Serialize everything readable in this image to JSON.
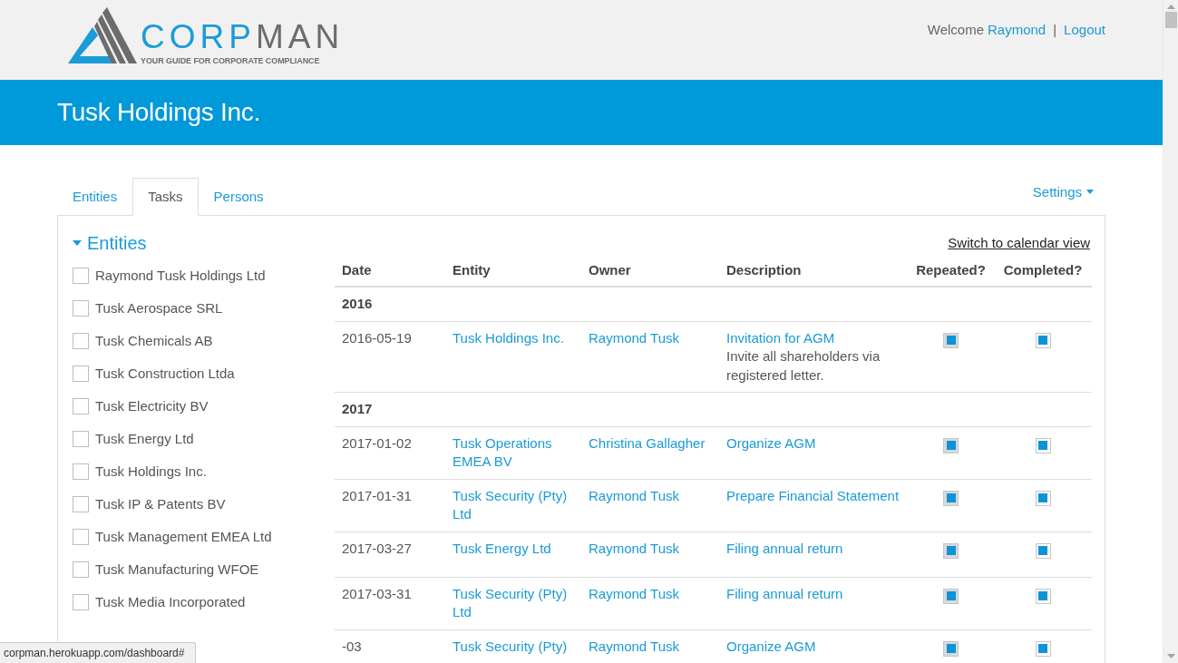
{
  "header": {
    "logo": {
      "wordmark": [
        {
          "text": "CORP",
          "color": "#1b9bd7"
        },
        {
          "text": "MAN",
          "color": "#6b6c6e"
        }
      ],
      "tagline": "YOUR GUIDE FOR CORPORATE COMPLIANCE"
    },
    "welcome": "Welcome",
    "user": "Raymond",
    "separator": "|",
    "logout": "Logout"
  },
  "banner": {
    "title": "Tusk Holdings Inc."
  },
  "tabs": [
    {
      "label": "Entities",
      "selected": false
    },
    {
      "label": "Tasks",
      "selected": true
    },
    {
      "label": "Persons",
      "selected": false
    }
  ],
  "settings": {
    "label": "Settings"
  },
  "entity_filter": {
    "title": "Entities",
    "expanded": true,
    "items": [
      {
        "label": "Raymond Tusk Holdings Ltd",
        "checked": false
      },
      {
        "label": "Tusk Aerospace SRL",
        "checked": false
      },
      {
        "label": "Tusk Chemicals AB",
        "checked": false
      },
      {
        "label": "Tusk Construction Ltda",
        "checked": false
      },
      {
        "label": "Tusk Electricity BV",
        "checked": false
      },
      {
        "label": "Tusk Energy Ltd",
        "checked": false
      },
      {
        "label": "Tusk Holdings Inc.",
        "checked": false
      },
      {
        "label": "Tusk IP & Patents BV",
        "checked": false
      },
      {
        "label": "Tusk Management EMEA Ltd",
        "checked": false
      },
      {
        "label": "Tusk Manufacturing WFOE",
        "checked": false
      },
      {
        "label": "Tusk Media Incorporated",
        "checked": false
      }
    ]
  },
  "calendar_link": "Switch to calendar view",
  "table": {
    "columns": [
      "Date",
      "Entity",
      "Owner",
      "Description",
      "Repeated?",
      "Completed?"
    ],
    "groups": [
      {
        "year": "2016",
        "rows": [
          {
            "date": "2016-05-19",
            "entity": "Tusk Holdings Inc.",
            "owner": "Raymond Tusk",
            "description": "Invitation for AGM",
            "note": "Invite all shareholders via registered letter.",
            "repeated": {
              "checked": true,
              "disabled": true
            },
            "completed": {
              "checked": true,
              "disabled": false
            }
          }
        ]
      },
      {
        "year": "2017",
        "rows": [
          {
            "date": "2017-01-02",
            "entity": "Tusk Operations EMEA BV",
            "owner": "Christina Gallagher",
            "description": "Organize AGM",
            "repeated": {
              "checked": true,
              "disabled": true
            },
            "completed": {
              "checked": true,
              "disabled": false
            }
          },
          {
            "date": "2017-01-31",
            "entity": "Tusk Security (Pty) Ltd",
            "owner": "Raymond Tusk",
            "description": "Prepare Financial Statement",
            "repeated": {
              "checked": true,
              "disabled": true
            },
            "completed": {
              "checked": true,
              "disabled": false
            }
          },
          {
            "date": "2017-03-27",
            "entity": "Tusk Energy Ltd",
            "owner": "Raymond Tusk",
            "description": "Filing annual return",
            "repeated": {
              "checked": true,
              "disabled": true
            },
            "completed": {
              "checked": true,
              "disabled": false
            }
          },
          {
            "date": "2017-03-31",
            "entity": "Tusk Security (Pty) Ltd",
            "owner": "Raymond Tusk",
            "description": "Filing annual return",
            "repeated": {
              "checked": true,
              "disabled": true
            },
            "completed": {
              "checked": true,
              "disabled": false
            }
          },
          {
            "date": "-03",
            "entity": "Tusk Security (Pty)",
            "owner": "Raymond Tusk",
            "description": "Organize AGM",
            "repeated": {
              "checked": true,
              "disabled": true
            },
            "completed": {
              "checked": true,
              "disabled": false
            }
          }
        ]
      }
    ]
  },
  "status_bar": {
    "url": "corpman.herokuapp.com/dashboard#"
  }
}
